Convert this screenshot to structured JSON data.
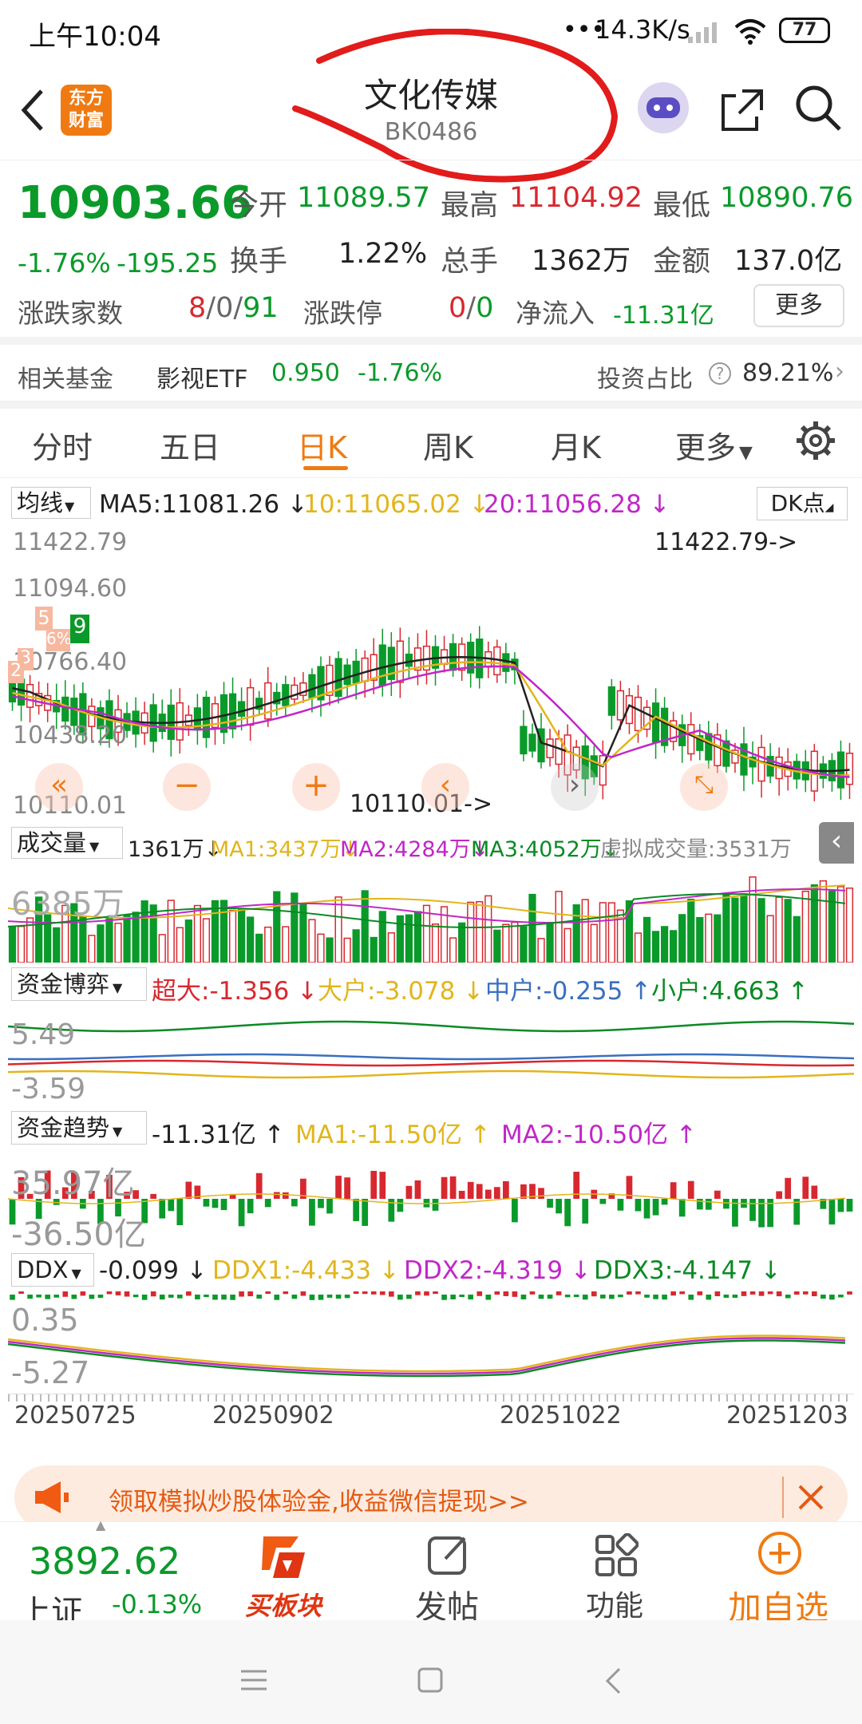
{
  "status": {
    "time": "上午10:04",
    "net_speed": "14.3K/s",
    "battery": "77"
  },
  "header": {
    "back_icon": "chevron-left-icon",
    "logo_line1": "东方",
    "logo_line2": "财富",
    "title": "文化传媒",
    "code": "BK0486"
  },
  "quote": {
    "price": "10903.66",
    "pct": "-1.76%",
    "change": "-195.25",
    "open_label": "今开",
    "open": "11089.57",
    "high_label": "最高",
    "high": "11104.92",
    "low_label": "最低",
    "low": "10890.76",
    "turnover_label": "换手",
    "turnover": "1.22%",
    "volume_label": "总手",
    "volume": "1362万",
    "amount_label": "金额",
    "amount": "137.0亿",
    "breadth_label": "涨跌家数",
    "breadth_up": "8",
    "breadth_sep1": "/",
    "breadth_flat": "0",
    "breadth_sep2": "/",
    "breadth_down": "91",
    "limit_label": "涨跌停",
    "limit_up": "0",
    "limit_sep": "/",
    "limit_down": "0",
    "inflow_label": "净流入",
    "inflow": "-11.31亿",
    "more_button": "更多"
  },
  "fund": {
    "label": "相关基金",
    "name": "影视ETF",
    "price": "0.950",
    "pct": "-1.76%",
    "ratio_label": "投资占比",
    "ratio": "89.21%"
  },
  "tabs": [
    "分时",
    "五日",
    "日K",
    "周K",
    "月K",
    "更多"
  ],
  "active_tab": "日K",
  "ma_bar": {
    "selector": "均线",
    "ma5": "MA5:11081.26",
    "ma10": "10:11065.02",
    "ma20": "20:11056.28",
    "dk_button": "DK点"
  },
  "kline": {
    "y_labels": [
      "11422.79",
      "11094.60",
      "10766.40",
      "10438.20",
      "10110.01"
    ],
    "max_note": "11422.79->",
    "min_note": "10110.01->",
    "float_tags": [
      "5",
      "6%",
      "9",
      "3",
      "2"
    ]
  },
  "volume": {
    "selector": "成交量",
    "value": "1361万",
    "ma1": "MA1:3437万",
    "ma2": "MA2:4284万",
    "ma3": "MA3:4052万",
    "virtual": "虚拟成交量:3531万",
    "y_label": "6385万"
  },
  "capital_game": {
    "selector": "资金博弈",
    "super": "超大:-1.356",
    "large": "大户:-3.078",
    "mid": "中户:-0.255",
    "small": "小户:4.663",
    "y_top": "5.49",
    "y_bottom": "-3.59"
  },
  "capital_trend": {
    "selector": "资金趋势",
    "value": "-11.31亿",
    "ma1": "MA1:-11.50亿",
    "ma2": "MA2:-10.50亿",
    "y_top": "35.97亿",
    "y_bottom": "-36.50亿"
  },
  "ddx": {
    "selector": "DDX",
    "value": "-0.099",
    "ddx1": "DDX1:-4.433",
    "ddx2": "DDX2:-4.319",
    "ddx3": "DDX3:-4.147",
    "y_top": "0.35",
    "y_bottom": "-5.27"
  },
  "dates": [
    "20250725",
    "20250902",
    "20251022",
    "20251203"
  ],
  "banner": {
    "text": "领取模拟炒股体验金,收益微信提现>>"
  },
  "bottom": {
    "index_price": "3892.62",
    "index_name": "上证",
    "index_pct": "-0.13%",
    "buy_label": "买板块",
    "post_label": "发帖",
    "func_label": "功能",
    "add_label": "加自选"
  },
  "colors": {
    "up": "#d8282f",
    "down": "#0a9a2a",
    "accent": "#f07a12"
  }
}
